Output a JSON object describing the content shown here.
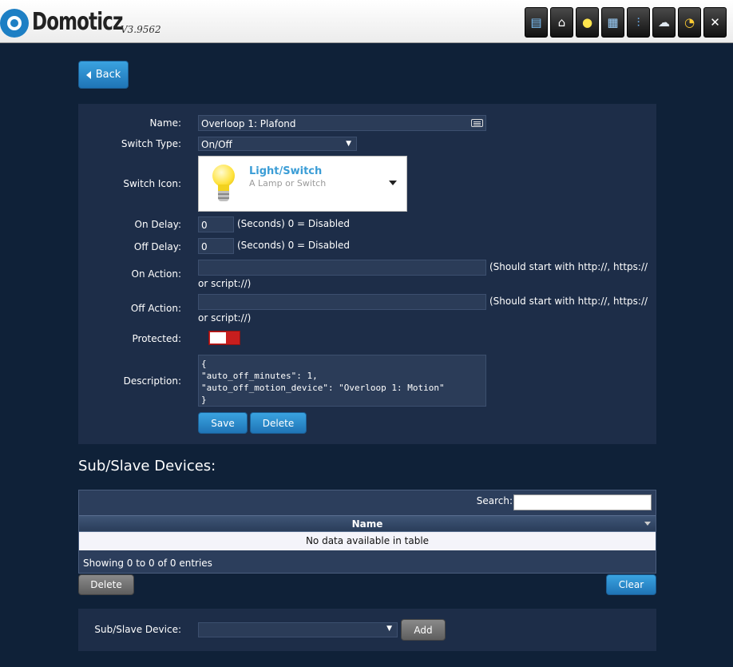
{
  "header": {
    "logo_text": "Domoticz",
    "version": "V3.9562",
    "nav_icons": [
      "dashboard-icon",
      "home-icon",
      "lightbulb-icon",
      "scenes-icon",
      "temperature-icon",
      "weather-icon",
      "utility-icon",
      "setup-icon"
    ]
  },
  "back_button": {
    "label": "Back"
  },
  "form": {
    "name": {
      "label": "Name:",
      "value": "Overloop 1: Plafond"
    },
    "switch_type": {
      "label": "Switch Type:",
      "value": "On/Off"
    },
    "switch_icon": {
      "label": "Switch Icon:",
      "title": "Light/Switch",
      "subtitle": "A Lamp or Switch"
    },
    "on_delay": {
      "label": "On Delay:",
      "value": "0",
      "note": "(Seconds) 0 = Disabled"
    },
    "off_delay": {
      "label": "Off Delay:",
      "value": "0",
      "note": "(Seconds) 0 = Disabled"
    },
    "on_action": {
      "label": "On Action:",
      "value": "",
      "note_line1": "(Should start with http://, https://",
      "note_line2": "or script://)"
    },
    "off_action": {
      "label": "Off Action:",
      "value": "",
      "note_line1": "(Should start with http://, https://",
      "note_line2": "or script://)"
    },
    "protected": {
      "label": "Protected:",
      "checked": false
    },
    "description": {
      "label": "Description:",
      "value": "{\n\"auto_off_minutes\": 1,\n\"auto_off_motion_device\": \"Overloop 1: Motion\"\n}"
    },
    "save_label": "Save",
    "delete_label": "Delete"
  },
  "sub_devices": {
    "title": "Sub/Slave Devices:",
    "search_label": "Search:",
    "search_value": "",
    "column_name": "Name",
    "empty_text": "No data available in table",
    "info_text": "Showing 0 to 0 of 0 entries",
    "delete_label": "Delete",
    "clear_label": "Clear"
  },
  "add_device": {
    "label": "Sub/Slave Device:",
    "selected": "",
    "add_label": "Add"
  },
  "colors": {
    "accent": "#2a8bd0",
    "panel": "#1d2d48",
    "background": "#0f2138",
    "toggle": "#c81e1e"
  }
}
